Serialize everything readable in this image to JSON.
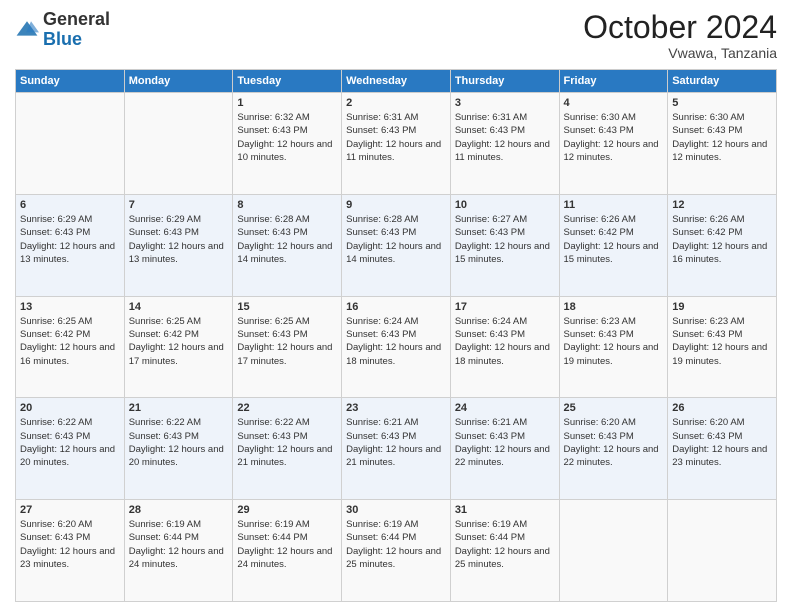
{
  "logo": {
    "general": "General",
    "blue": "Blue"
  },
  "header": {
    "month_title": "October 2024",
    "location": "Vwawa, Tanzania"
  },
  "days_of_week": [
    "Sunday",
    "Monday",
    "Tuesday",
    "Wednesday",
    "Thursday",
    "Friday",
    "Saturday"
  ],
  "weeks": [
    [
      {
        "day": "",
        "sunrise": "",
        "sunset": "",
        "daylight": ""
      },
      {
        "day": "",
        "sunrise": "",
        "sunset": "",
        "daylight": ""
      },
      {
        "day": "1",
        "sunrise": "Sunrise: 6:32 AM",
        "sunset": "Sunset: 6:43 PM",
        "daylight": "Daylight: 12 hours and 10 minutes."
      },
      {
        "day": "2",
        "sunrise": "Sunrise: 6:31 AM",
        "sunset": "Sunset: 6:43 PM",
        "daylight": "Daylight: 12 hours and 11 minutes."
      },
      {
        "day": "3",
        "sunrise": "Sunrise: 6:31 AM",
        "sunset": "Sunset: 6:43 PM",
        "daylight": "Daylight: 12 hours and 11 minutes."
      },
      {
        "day": "4",
        "sunrise": "Sunrise: 6:30 AM",
        "sunset": "Sunset: 6:43 PM",
        "daylight": "Daylight: 12 hours and 12 minutes."
      },
      {
        "day": "5",
        "sunrise": "Sunrise: 6:30 AM",
        "sunset": "Sunset: 6:43 PM",
        "daylight": "Daylight: 12 hours and 12 minutes."
      }
    ],
    [
      {
        "day": "6",
        "sunrise": "Sunrise: 6:29 AM",
        "sunset": "Sunset: 6:43 PM",
        "daylight": "Daylight: 12 hours and 13 minutes."
      },
      {
        "day": "7",
        "sunrise": "Sunrise: 6:29 AM",
        "sunset": "Sunset: 6:43 PM",
        "daylight": "Daylight: 12 hours and 13 minutes."
      },
      {
        "day": "8",
        "sunrise": "Sunrise: 6:28 AM",
        "sunset": "Sunset: 6:43 PM",
        "daylight": "Daylight: 12 hours and 14 minutes."
      },
      {
        "day": "9",
        "sunrise": "Sunrise: 6:28 AM",
        "sunset": "Sunset: 6:43 PM",
        "daylight": "Daylight: 12 hours and 14 minutes."
      },
      {
        "day": "10",
        "sunrise": "Sunrise: 6:27 AM",
        "sunset": "Sunset: 6:43 PM",
        "daylight": "Daylight: 12 hours and 15 minutes."
      },
      {
        "day": "11",
        "sunrise": "Sunrise: 6:26 AM",
        "sunset": "Sunset: 6:42 PM",
        "daylight": "Daylight: 12 hours and 15 minutes."
      },
      {
        "day": "12",
        "sunrise": "Sunrise: 6:26 AM",
        "sunset": "Sunset: 6:42 PM",
        "daylight": "Daylight: 12 hours and 16 minutes."
      }
    ],
    [
      {
        "day": "13",
        "sunrise": "Sunrise: 6:25 AM",
        "sunset": "Sunset: 6:42 PM",
        "daylight": "Daylight: 12 hours and 16 minutes."
      },
      {
        "day": "14",
        "sunrise": "Sunrise: 6:25 AM",
        "sunset": "Sunset: 6:42 PM",
        "daylight": "Daylight: 12 hours and 17 minutes."
      },
      {
        "day": "15",
        "sunrise": "Sunrise: 6:25 AM",
        "sunset": "Sunset: 6:43 PM",
        "daylight": "Daylight: 12 hours and 17 minutes."
      },
      {
        "day": "16",
        "sunrise": "Sunrise: 6:24 AM",
        "sunset": "Sunset: 6:43 PM",
        "daylight": "Daylight: 12 hours and 18 minutes."
      },
      {
        "day": "17",
        "sunrise": "Sunrise: 6:24 AM",
        "sunset": "Sunset: 6:43 PM",
        "daylight": "Daylight: 12 hours and 18 minutes."
      },
      {
        "day": "18",
        "sunrise": "Sunrise: 6:23 AM",
        "sunset": "Sunset: 6:43 PM",
        "daylight": "Daylight: 12 hours and 19 minutes."
      },
      {
        "day": "19",
        "sunrise": "Sunrise: 6:23 AM",
        "sunset": "Sunset: 6:43 PM",
        "daylight": "Daylight: 12 hours and 19 minutes."
      }
    ],
    [
      {
        "day": "20",
        "sunrise": "Sunrise: 6:22 AM",
        "sunset": "Sunset: 6:43 PM",
        "daylight": "Daylight: 12 hours and 20 minutes."
      },
      {
        "day": "21",
        "sunrise": "Sunrise: 6:22 AM",
        "sunset": "Sunset: 6:43 PM",
        "daylight": "Daylight: 12 hours and 20 minutes."
      },
      {
        "day": "22",
        "sunrise": "Sunrise: 6:22 AM",
        "sunset": "Sunset: 6:43 PM",
        "daylight": "Daylight: 12 hours and 21 minutes."
      },
      {
        "day": "23",
        "sunrise": "Sunrise: 6:21 AM",
        "sunset": "Sunset: 6:43 PM",
        "daylight": "Daylight: 12 hours and 21 minutes."
      },
      {
        "day": "24",
        "sunrise": "Sunrise: 6:21 AM",
        "sunset": "Sunset: 6:43 PM",
        "daylight": "Daylight: 12 hours and 22 minutes."
      },
      {
        "day": "25",
        "sunrise": "Sunrise: 6:20 AM",
        "sunset": "Sunset: 6:43 PM",
        "daylight": "Daylight: 12 hours and 22 minutes."
      },
      {
        "day": "26",
        "sunrise": "Sunrise: 6:20 AM",
        "sunset": "Sunset: 6:43 PM",
        "daylight": "Daylight: 12 hours and 23 minutes."
      }
    ],
    [
      {
        "day": "27",
        "sunrise": "Sunrise: 6:20 AM",
        "sunset": "Sunset: 6:43 PM",
        "daylight": "Daylight: 12 hours and 23 minutes."
      },
      {
        "day": "28",
        "sunrise": "Sunrise: 6:19 AM",
        "sunset": "Sunset: 6:44 PM",
        "daylight": "Daylight: 12 hours and 24 minutes."
      },
      {
        "day": "29",
        "sunrise": "Sunrise: 6:19 AM",
        "sunset": "Sunset: 6:44 PM",
        "daylight": "Daylight: 12 hours and 24 minutes."
      },
      {
        "day": "30",
        "sunrise": "Sunrise: 6:19 AM",
        "sunset": "Sunset: 6:44 PM",
        "daylight": "Daylight: 12 hours and 25 minutes."
      },
      {
        "day": "31",
        "sunrise": "Sunrise: 6:19 AM",
        "sunset": "Sunset: 6:44 PM",
        "daylight": "Daylight: 12 hours and 25 minutes."
      },
      {
        "day": "",
        "sunrise": "",
        "sunset": "",
        "daylight": ""
      },
      {
        "day": "",
        "sunrise": "",
        "sunset": "",
        "daylight": ""
      }
    ]
  ]
}
